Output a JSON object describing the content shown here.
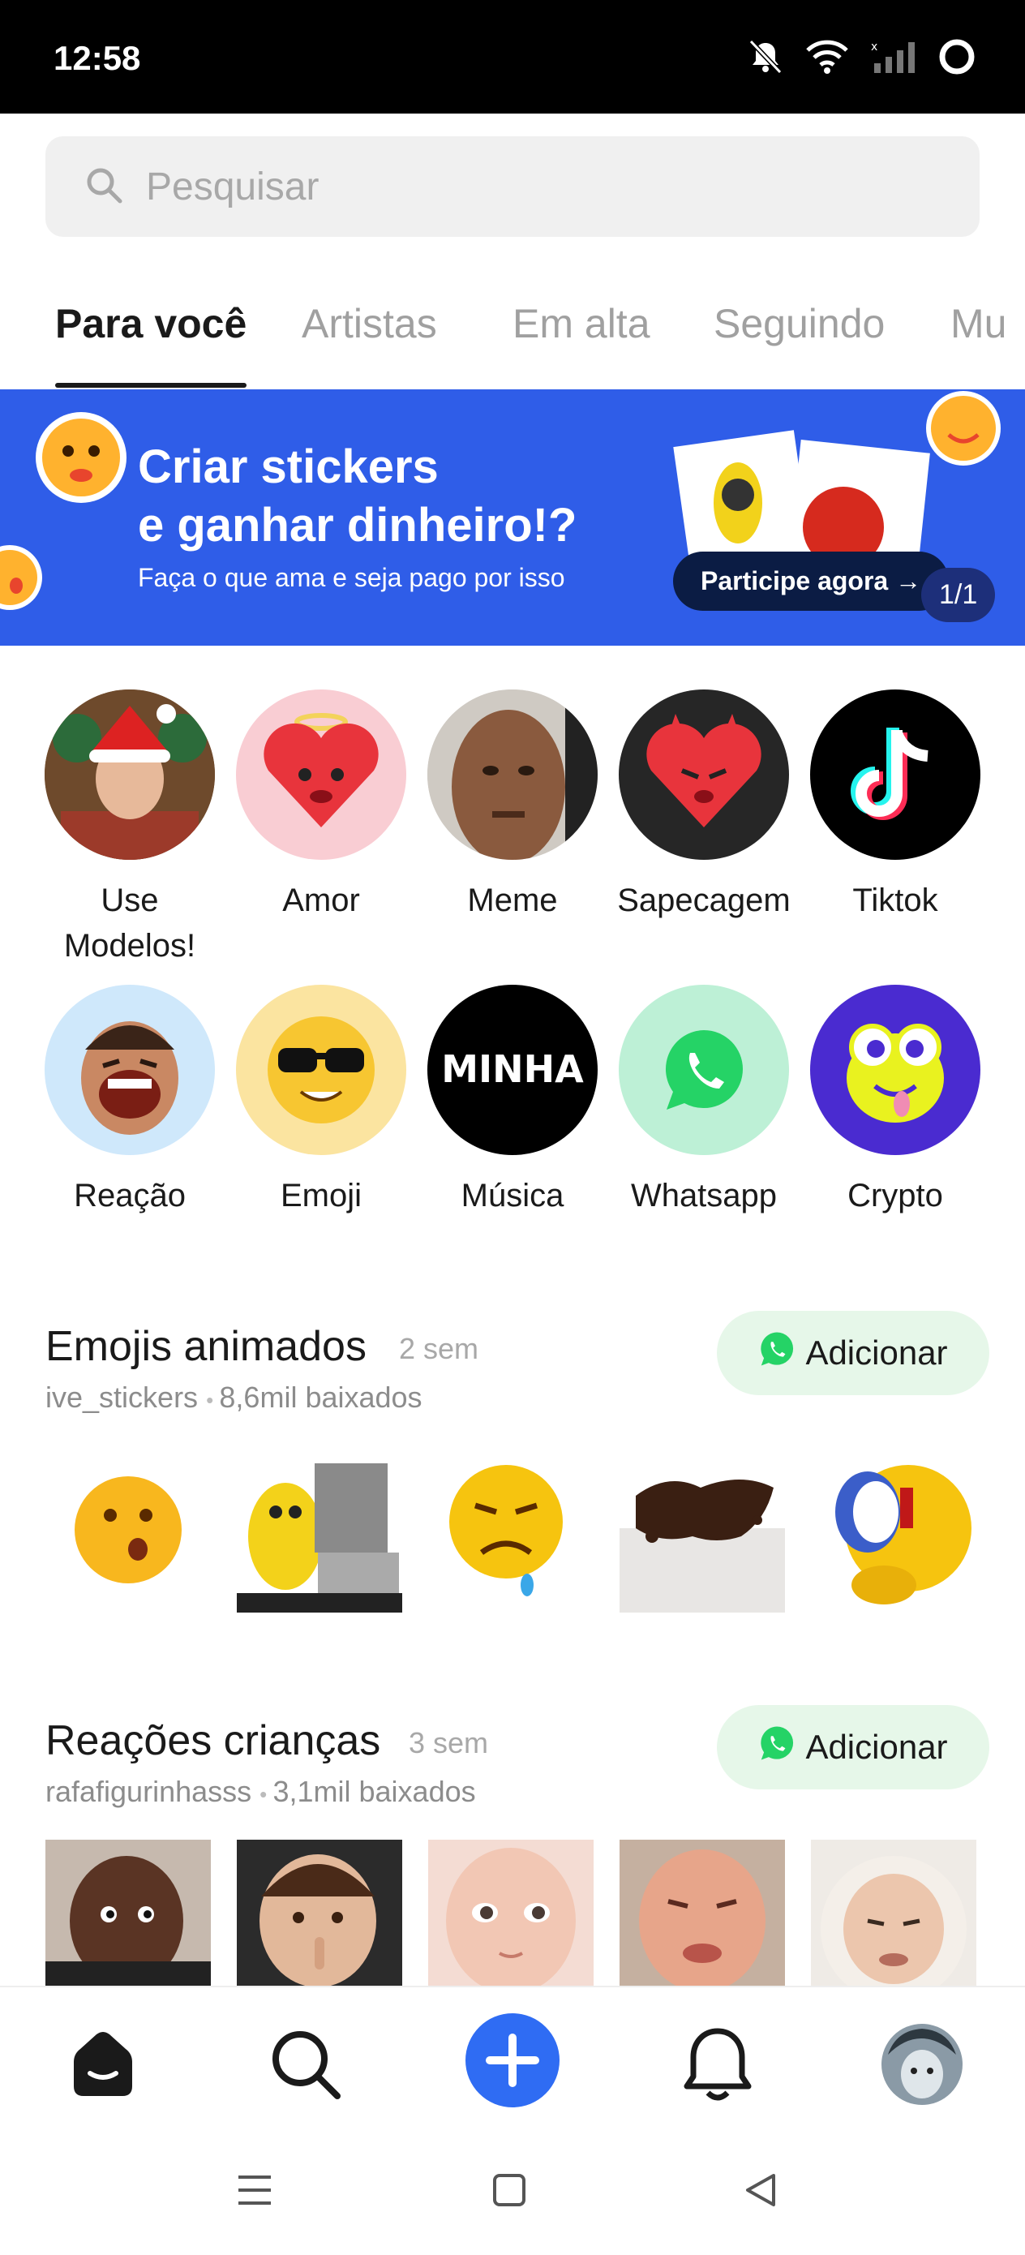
{
  "status_bar": {
    "time": "12:58",
    "icons": [
      "notifications-off-icon",
      "wifi-icon",
      "signal-icon",
      "loading-icon"
    ]
  },
  "search": {
    "placeholder": "Pesquisar",
    "icon": "search-icon"
  },
  "tabs": [
    {
      "label": "Para você",
      "active": true
    },
    {
      "label": "Artistas",
      "active": false
    },
    {
      "label": "Em alta",
      "active": false
    },
    {
      "label": "Seguindo",
      "active": false
    },
    {
      "label": "Mu",
      "active": false
    }
  ],
  "banner": {
    "title_line1": "Criar stickers",
    "title_line2": "e ganhar dinheiro!?",
    "subtitle": "Faça o que ama e seja pago por isso",
    "cta": "Participe agora →",
    "page": "1/1",
    "background": "#2f5de8"
  },
  "categories": [
    {
      "label": "Use Modelos!",
      "icon": "santa-portrait-icon",
      "bg": "#a06a3a"
    },
    {
      "label": "Amor",
      "icon": "heart-icon",
      "bg": "#f9cdd3"
    },
    {
      "label": "Meme",
      "icon": "meme-face-icon",
      "bg": "#6b5240"
    },
    {
      "label": "Sapecagem",
      "icon": "devil-heart-icon",
      "bg": "#2a2a2a"
    },
    {
      "label": "Tiktok",
      "icon": "tiktok-icon",
      "bg": "#000000"
    },
    {
      "label": "Reação",
      "icon": "laughing-face-icon",
      "bg": "#cfe8fb"
    },
    {
      "label": "Emoji",
      "icon": "sunglasses-emoji-icon",
      "bg": "#fbe4a0"
    },
    {
      "label": "Música",
      "icon": "minha-text-icon",
      "bg": "#000000",
      "text": "MINHA"
    },
    {
      "label": "Whatsapp",
      "icon": "whatsapp-icon",
      "bg": "#bdf0d6"
    },
    {
      "label": "Crypto",
      "icon": "frog-face-icon",
      "bg": "#4a2bd0"
    }
  ],
  "sections": [
    {
      "title": "Emojis animados",
      "age": "2 sem",
      "author": "ive_stickers",
      "downloads": "8,6mil baixados",
      "add_label": "Adicionar",
      "stickers": [
        "surprised-emoji-icon",
        "computer-emoji-icon",
        "sad-emoji-icon",
        "dirt-splash-icon",
        "eye-emoji-icon"
      ]
    },
    {
      "title": "Reações crianças",
      "age": "3 sem",
      "author": "rafafigurinhasss",
      "downloads": "3,1mil baixados",
      "add_label": "Adicionar",
      "stickers": [
        "child-face-1",
        "child-face-2",
        "baby-face-1",
        "baby-face-2",
        "baby-face-3"
      ]
    }
  ],
  "bottom_nav": [
    "home-icon",
    "search-icon",
    "add-icon",
    "bell-icon",
    "profile-avatar"
  ],
  "colors": {
    "accent": "#2f6cf3",
    "whatsapp_green": "#25d366",
    "add_button_bg": "#e6f7e9"
  }
}
